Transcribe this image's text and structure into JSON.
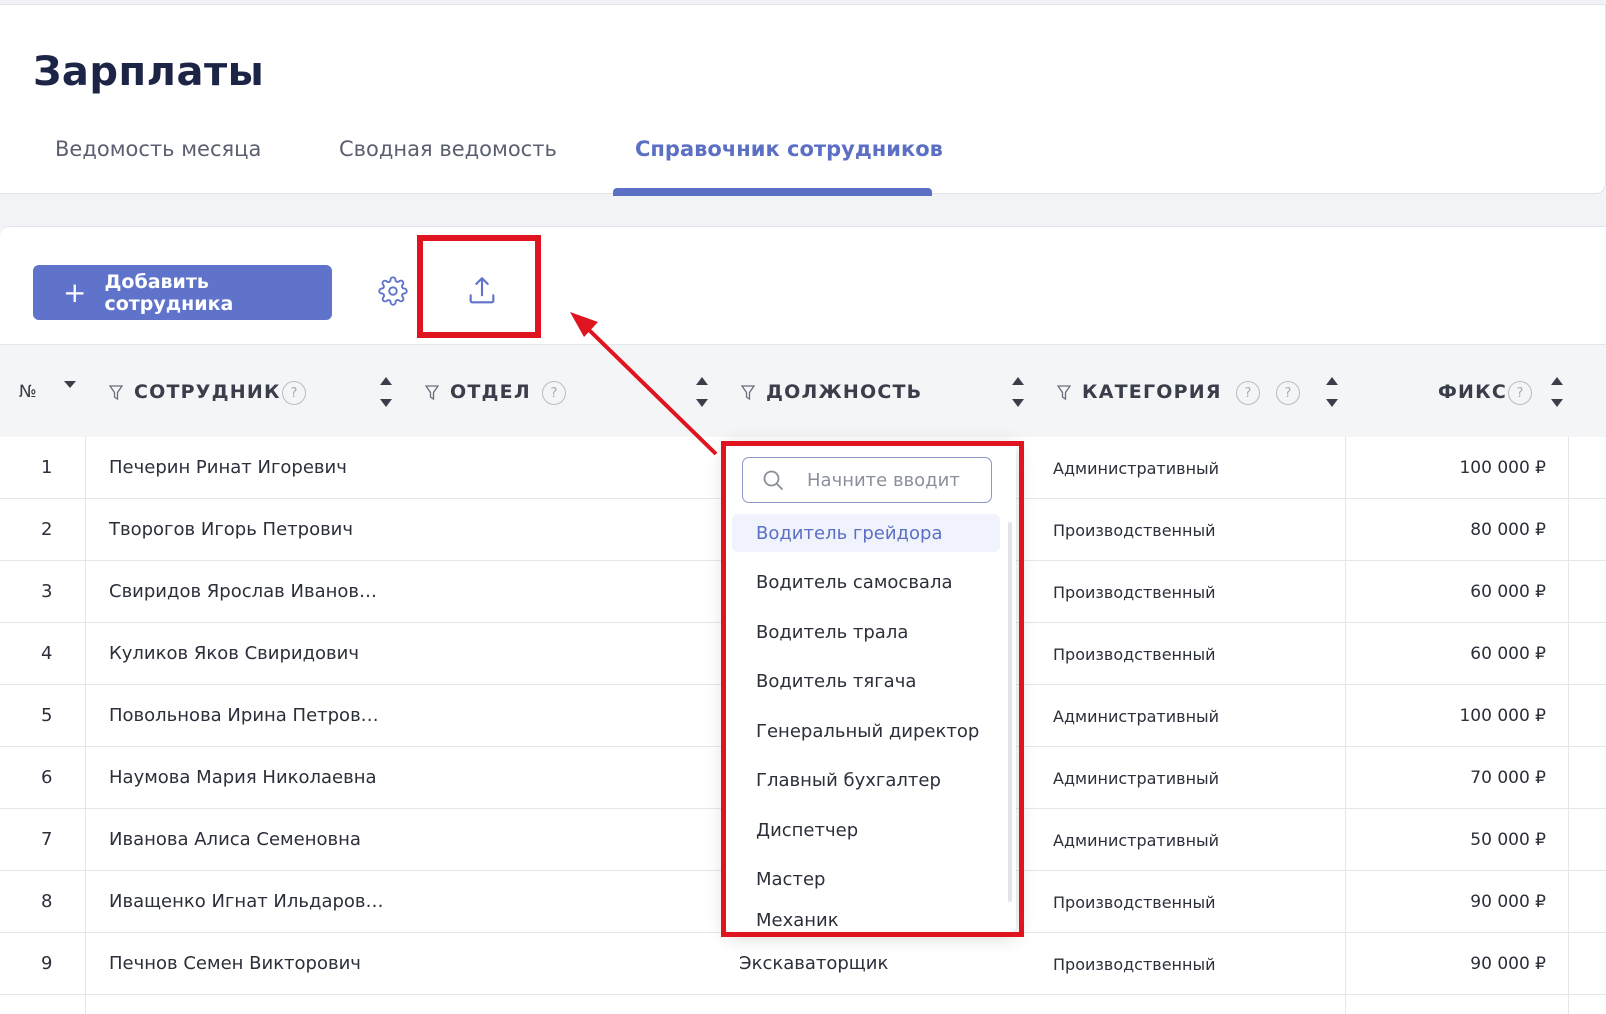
{
  "page": {
    "title": "Зарплаты"
  },
  "tabs": [
    {
      "label": "Ведомость месяца",
      "active": false
    },
    {
      "label": "Сводная ведомость",
      "active": false
    },
    {
      "label": "Справочник сотрудников",
      "active": true
    }
  ],
  "toolbar": {
    "add_label": "Добавить сотрудника",
    "settings_icon": "gear-icon",
    "upload_icon": "upload-icon"
  },
  "table": {
    "columns": {
      "num": "№",
      "employee": "СОТРУДНИК",
      "department": "ОТДЕЛ",
      "position": "ДОЛЖНОСТЬ",
      "category": "КАТЕГОРИЯ",
      "fix": "ФИКС",
      "help_mark": "?"
    },
    "rows": [
      {
        "num": "1",
        "employee": "Печерин Ринат Игоревич",
        "position": "",
        "category": "Административный",
        "fix": "100 000 ₽"
      },
      {
        "num": "2",
        "employee": "Творогов Игорь Петрович",
        "position": "",
        "category": "Производственный",
        "fix": "80 000 ₽"
      },
      {
        "num": "3",
        "employee": "Свиридов Ярослав Иванов…",
        "position": "",
        "category": "Производственный",
        "fix": "60 000 ₽"
      },
      {
        "num": "4",
        "employee": "Куликов Яков Свиридович",
        "position": "",
        "category": "Производственный",
        "fix": "60 000 ₽"
      },
      {
        "num": "5",
        "employee": "Повольнова Ирина Петров…",
        "position": "",
        "category": "Административный",
        "fix": "100 000 ₽"
      },
      {
        "num": "6",
        "employee": "Наумова Мария Николаевна",
        "position": "",
        "category": "Административный",
        "fix": "70 000 ₽"
      },
      {
        "num": "7",
        "employee": "Иванова Алиса Семеновна",
        "position": "",
        "category": "Административный",
        "fix": "50 000 ₽"
      },
      {
        "num": "8",
        "employee": "Иващенко Игнат Ильдаров…",
        "position": "",
        "category": "Производственный",
        "fix": "90 000 ₽"
      },
      {
        "num": "9",
        "employee": "Печнов Семен Викторович",
        "position": "Экскаваторщик",
        "category": "Производственный",
        "fix": "90 000 ₽"
      }
    ]
  },
  "dropdown": {
    "search_placeholder": "Начните вводить",
    "items": [
      "Водитель грейдора",
      "Водитель самосвала",
      "Водитель трала",
      "Водитель тягача",
      "Генеральный директор",
      "Главный бухгалтер",
      "Диспетчер",
      "Мастер",
      "Механик"
    ],
    "active_index": 0
  },
  "colors": {
    "accent": "#5f73cb",
    "highlight": "#e0141e"
  }
}
